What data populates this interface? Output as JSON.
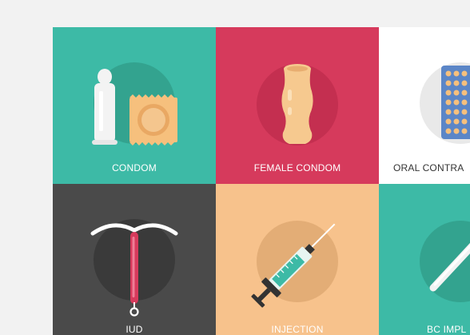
{
  "colors": {
    "teal": "#3dbaa6",
    "crimson": "#d63a5c",
    "white": "#ffffff",
    "charcoal": "#4a4a4a",
    "peach": "#f7c28c",
    "teal_dark": "#33a895",
    "tan": "#f6c07d",
    "pill_blue": "#5b86c7"
  },
  "tiles": [
    {
      "label": "CONDOM",
      "icon": "condom-icon"
    },
    {
      "label": "FEMALE CONDOM",
      "icon": "female-condom-icon"
    },
    {
      "label": "ORAL CONTRA",
      "icon": "pill-pack-icon"
    },
    {
      "label": "IUD",
      "icon": "iud-icon"
    },
    {
      "label": "INJECTION",
      "icon": "syringe-icon"
    },
    {
      "label": "BC IMPL",
      "icon": "implant-icon"
    }
  ]
}
